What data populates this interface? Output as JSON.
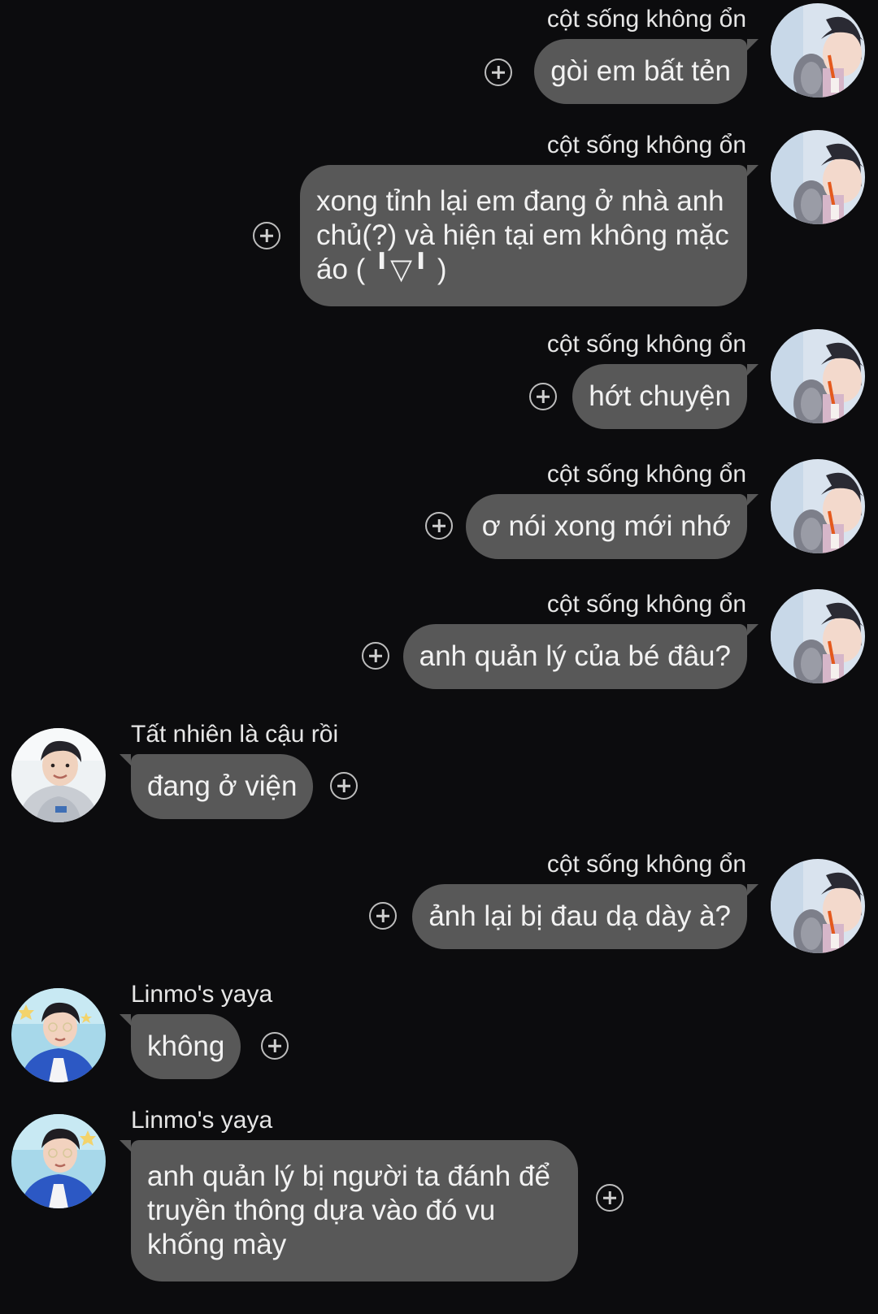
{
  "chat": {
    "messages": [
      {
        "direction": "out",
        "sender": "cột sống không ổn",
        "text": "gòi em bất tẻn",
        "avatar": "avatar-right"
      },
      {
        "direction": "out",
        "sender": "cột sống không ổn",
        "text": "xong tỉnh lại em đang ở nhà anh chủ(?) và hiện tại em không mặc áo ( ╹▽╹ )",
        "avatar": "avatar-right"
      },
      {
        "direction": "out",
        "sender": "cột sống không ổn",
        "text": "hớt chuyện",
        "avatar": "avatar-right"
      },
      {
        "direction": "out",
        "sender": "cột sống không ổn",
        "text": "ơ nói xong mới nhớ",
        "avatar": "avatar-right"
      },
      {
        "direction": "out",
        "sender": "cột sống không ổn",
        "text": "anh quản lý của bé đâu?",
        "avatar": "avatar-right"
      },
      {
        "direction": "in",
        "sender": "Tất nhiên là cậu rồi",
        "text": "đang ở viện",
        "avatar": "avatar-hoodie"
      },
      {
        "direction": "out",
        "sender": "cột sống không ổn",
        "text": "ảnh lại bị đau dạ dày à?",
        "avatar": "avatar-right"
      },
      {
        "direction": "in",
        "sender": "Linmo's yaya",
        "text": "không",
        "avatar": "avatar-bluejacket"
      },
      {
        "direction": "in",
        "sender": "Linmo's yaya",
        "text": "anh quản lý bị người ta đánh để truyền thông dựa vào đó vu khống mày",
        "avatar": "avatar-bluejacket"
      }
    ]
  },
  "colors": {
    "background": "#0c0c0e",
    "bubble": "#585858",
    "text": "#f2f2f2",
    "sender_text": "#e6e6e6",
    "react_icon": "#bdbdbd"
  },
  "icons": {
    "react": "add-reaction-icon"
  }
}
